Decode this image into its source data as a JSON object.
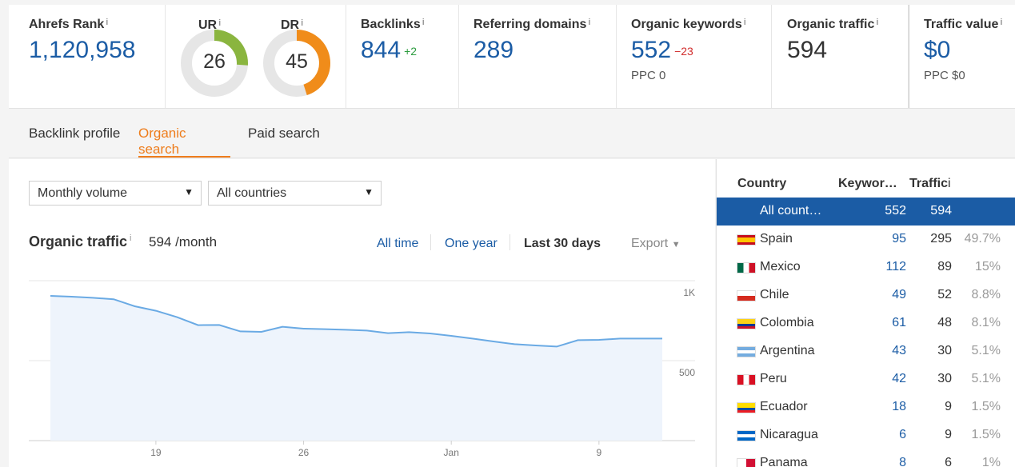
{
  "metrics": {
    "ahrefs_rank": {
      "label": "Ahrefs Rank",
      "value": "1,120,958"
    },
    "ur": {
      "label": "UR",
      "value": "26",
      "score": 26,
      "color": "#8ab53f"
    },
    "dr": {
      "label": "DR",
      "value": "45",
      "score": 45,
      "color": "#f08c1a"
    },
    "backlinks": {
      "label": "Backlinks",
      "value": "844",
      "delta": "+2"
    },
    "referring_domains": {
      "label": "Referring domains",
      "value": "289"
    },
    "organic_keywords": {
      "label": "Organic keywords",
      "value": "552",
      "delta": "−23",
      "sub": "PPC 0"
    },
    "organic_traffic": {
      "label": "Organic traffic",
      "value": "594"
    },
    "traffic_value": {
      "label": "Traffic value",
      "value": "$0",
      "sub": "PPC $0"
    },
    "info_mark": "i"
  },
  "tabs": [
    {
      "label": "Backlink profile",
      "active": false
    },
    {
      "label": "Organic search",
      "active": true
    },
    {
      "label": "Paid search",
      "active": false
    }
  ],
  "filters": {
    "volume": "Monthly volume",
    "countries": "All countries",
    "caret": "▼"
  },
  "chart_header": {
    "title": "Organic traffic",
    "subtitle": "594 /month",
    "ranges": [
      "All time",
      "One year",
      "Last 30 days"
    ],
    "active_range": "Last 30 days",
    "export": "Export"
  },
  "chart_data": {
    "type": "area",
    "series": [
      {
        "values": [
          905,
          900,
          893,
          884,
          840,
          812,
          772,
          722,
          723,
          683,
          680,
          712,
          700,
          697,
          693,
          688,
          672,
          678,
          670,
          655,
          638,
          620,
          603,
          595,
          588,
          628,
          630,
          638,
          638,
          638
        ]
      }
    ],
    "x_tick_labels": [
      "19",
      "26",
      "Jan",
      "9"
    ],
    "y_tick_labels": [
      "1K",
      "500"
    ],
    "ylim": [
      0,
      1000
    ],
    "grid": true,
    "color": "#6aaae4"
  },
  "countries": {
    "headers": {
      "country": "Country",
      "keywords": "Keywor…",
      "traffic": "Traffic"
    },
    "rows": [
      {
        "name": "All count…",
        "keywords": "552",
        "traffic": "594",
        "pct": "",
        "flag": "none",
        "selected": true
      },
      {
        "name": "Spain",
        "keywords": "95",
        "traffic": "295",
        "pct": "49.7%",
        "flag": "spain"
      },
      {
        "name": "Mexico",
        "keywords": "112",
        "traffic": "89",
        "pct": "15%",
        "flag": "mexico"
      },
      {
        "name": "Chile",
        "keywords": "49",
        "traffic": "52",
        "pct": "8.8%",
        "flag": "chile"
      },
      {
        "name": "Colombia",
        "keywords": "61",
        "traffic": "48",
        "pct": "8.1%",
        "flag": "colombia"
      },
      {
        "name": "Argentina",
        "keywords": "43",
        "traffic": "30",
        "pct": "5.1%",
        "flag": "argentina"
      },
      {
        "name": "Peru",
        "keywords": "42",
        "traffic": "30",
        "pct": "5.1%",
        "flag": "peru"
      },
      {
        "name": "Ecuador",
        "keywords": "18",
        "traffic": "9",
        "pct": "1.5%",
        "flag": "ecuador"
      },
      {
        "name": "Nicaragua",
        "keywords": "6",
        "traffic": "9",
        "pct": "1.5%",
        "flag": "nicaragua"
      },
      {
        "name": "Panama",
        "keywords": "8",
        "traffic": "6",
        "pct": "1%",
        "flag": "panama"
      }
    ]
  }
}
